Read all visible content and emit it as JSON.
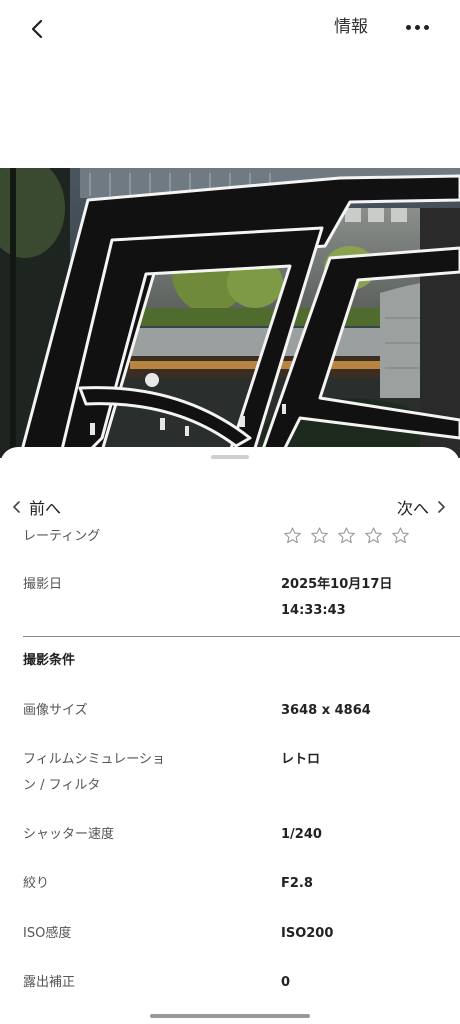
{
  "header": {
    "info_label": "情報"
  },
  "navigation": {
    "prev_label": "前へ",
    "next_label": "次へ"
  },
  "rating": {
    "label": "レーティング",
    "value": 0,
    "max": 5
  },
  "shoot_date": {
    "label": "撮影日",
    "date": "2025年10月17日",
    "time": "14:33:43"
  },
  "conditions": {
    "title": "撮影条件",
    "rows": [
      {
        "label": "画像サイズ",
        "value": "3648 x 4864"
      },
      {
        "label_line1": "フィルムシミュレーショ",
        "label_line2": "ン / フィルタ",
        "value": "レトロ"
      },
      {
        "label": "シャッター速度",
        "value": "1/240"
      },
      {
        "label": "絞り",
        "value": "F2.8"
      },
      {
        "label": "ISO感度",
        "value": "ISO200"
      },
      {
        "label": "露出補正",
        "value": "0"
      }
    ]
  },
  "colors": {
    "sheet_background": "#ffffff",
    "divider": "#8a8a8a",
    "star_outline": "#9a9a9a"
  },
  "icons": [
    "back-chevron-icon",
    "more-dots-icon",
    "chevron-left-icon",
    "chevron-right-icon",
    "star-outline-icon"
  ]
}
